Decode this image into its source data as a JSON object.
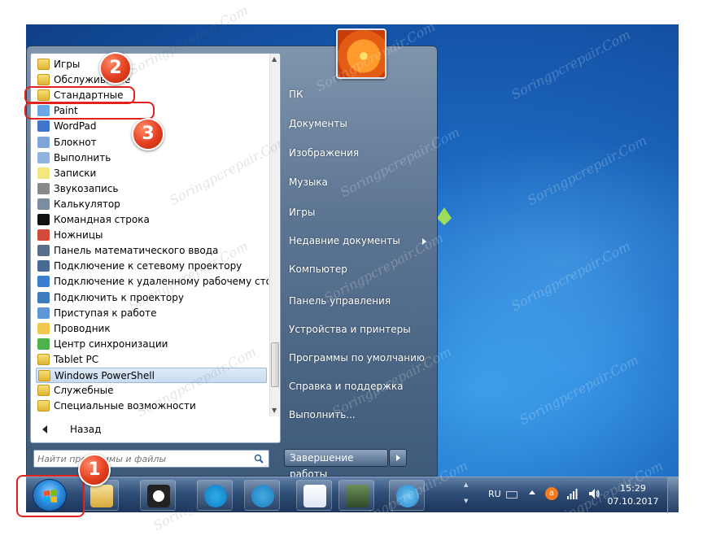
{
  "programs": [
    {
      "label": "Игры",
      "icon": "folder-icon"
    },
    {
      "label": "Обслуживание",
      "icon": "folder-icon"
    },
    {
      "label": "Стандартные",
      "icon": "folder-icon"
    },
    {
      "label": "Paint",
      "icon": "paint-icon"
    },
    {
      "label": "WordPad",
      "icon": "wordpad-icon"
    },
    {
      "label": "Блокнот",
      "icon": "notepad-icon"
    },
    {
      "label": "Выполнить",
      "icon": "run-icon"
    },
    {
      "label": "Записки",
      "icon": "sticky-notes-icon"
    },
    {
      "label": "Звукозапись",
      "icon": "microphone-icon"
    },
    {
      "label": "Калькулятор",
      "icon": "calculator-icon"
    },
    {
      "label": "Командная строка",
      "icon": "cmd-icon"
    },
    {
      "label": "Ножницы",
      "icon": "scissors-icon"
    },
    {
      "label": "Панель математического ввода",
      "icon": "math-input-icon"
    },
    {
      "label": "Подключение к сетевому проектору",
      "icon": "network-projector-icon"
    },
    {
      "label": "Подключение к удаленному рабочему столу",
      "icon": "remote-desktop-icon"
    },
    {
      "label": "Подключить к проектору",
      "icon": "projector-icon"
    },
    {
      "label": "Приступая к работе",
      "icon": "getting-started-icon"
    },
    {
      "label": "Проводник",
      "icon": "explorer-icon"
    },
    {
      "label": "Центр синхронизации",
      "icon": "sync-center-icon"
    },
    {
      "label": "Tablet PC",
      "icon": "folder-icon"
    },
    {
      "label": "Windows PowerShell",
      "icon": "folder-icon"
    },
    {
      "label": "Служебные",
      "icon": "folder-icon"
    },
    {
      "label": "Специальные возможности",
      "icon": "folder-icon"
    }
  ],
  "back_label": "Назад",
  "search": {
    "placeholder": "Найти программы и файлы"
  },
  "right_links": [
    {
      "label": "ПК"
    },
    {
      "label": "Документы"
    },
    {
      "label": "Изображения"
    },
    {
      "label": "Музыка"
    },
    {
      "label": "Игры"
    },
    {
      "label": "Недавние документы"
    },
    {
      "label": "Компьютер"
    },
    {
      "label": "Панель управления"
    },
    {
      "label": "Устройства и принтеры"
    },
    {
      "label": "Программы по умолчанию"
    },
    {
      "label": "Справка и поддержка"
    },
    {
      "label": "Выполнить..."
    }
  ],
  "shutdown_label": "Завершение работы",
  "taskbar_apps": [
    "explorer-icon",
    "panda-icon",
    "skype-icon",
    "telegram-icon",
    "word-icon",
    "task-manager-icon",
    "seamonkey-icon"
  ],
  "tray": {
    "lang": "RU",
    "time": "15:29",
    "date": "07.10.2017"
  },
  "callouts": [
    "1",
    "2",
    "3"
  ],
  "watermark": "Soringpcrepair.Com",
  "colors": {
    "highlight": "#e0231d",
    "selected_row": "#c8dbf1",
    "callout": "#e33e1f"
  }
}
